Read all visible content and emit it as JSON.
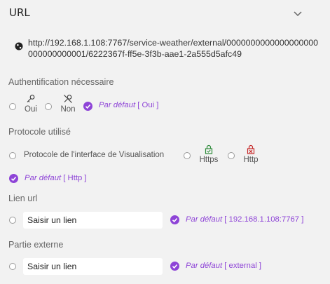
{
  "header": {
    "title": "URL",
    "chevron_icon": "chevron-down-icon"
  },
  "url": {
    "icon": "globe-icon",
    "value": "http://192.168.1.108:7767/service-weather/external/0000000000000000000000000000001/6222367f-ff5e-3f3b-aae1-2a555d5afc49"
  },
  "auth": {
    "title": "Authentification nécessaire",
    "options": [
      {
        "label": "Oui",
        "icon": "key-icon"
      },
      {
        "label": "Non",
        "icon": "key-off-icon"
      }
    ],
    "default_prefix": "Par défaut",
    "default_value": "[ Oui ]"
  },
  "protocol": {
    "title": "Protocole utilisé",
    "options": [
      {
        "label": "Protocole de l'interface de Visualisation"
      },
      {
        "label": "Https",
        "icon": "lock-check-icon"
      },
      {
        "label": "Http",
        "icon": "lock-x-icon"
      }
    ],
    "default_prefix": "Par défaut",
    "default_value": "[ Http ]"
  },
  "link": {
    "title": "Lien url",
    "placeholder": "Saisir un lien",
    "default_prefix": "Par défaut",
    "default_value": "[ 192.168.1.108:7767 ]"
  },
  "external": {
    "title": "Partie externe",
    "placeholder": "Saisir un lien",
    "default_prefix": "Par défaut",
    "default_value": "[ external ]"
  },
  "colors": {
    "accent": "#8e44d7",
    "background": "#f2f2f2"
  }
}
